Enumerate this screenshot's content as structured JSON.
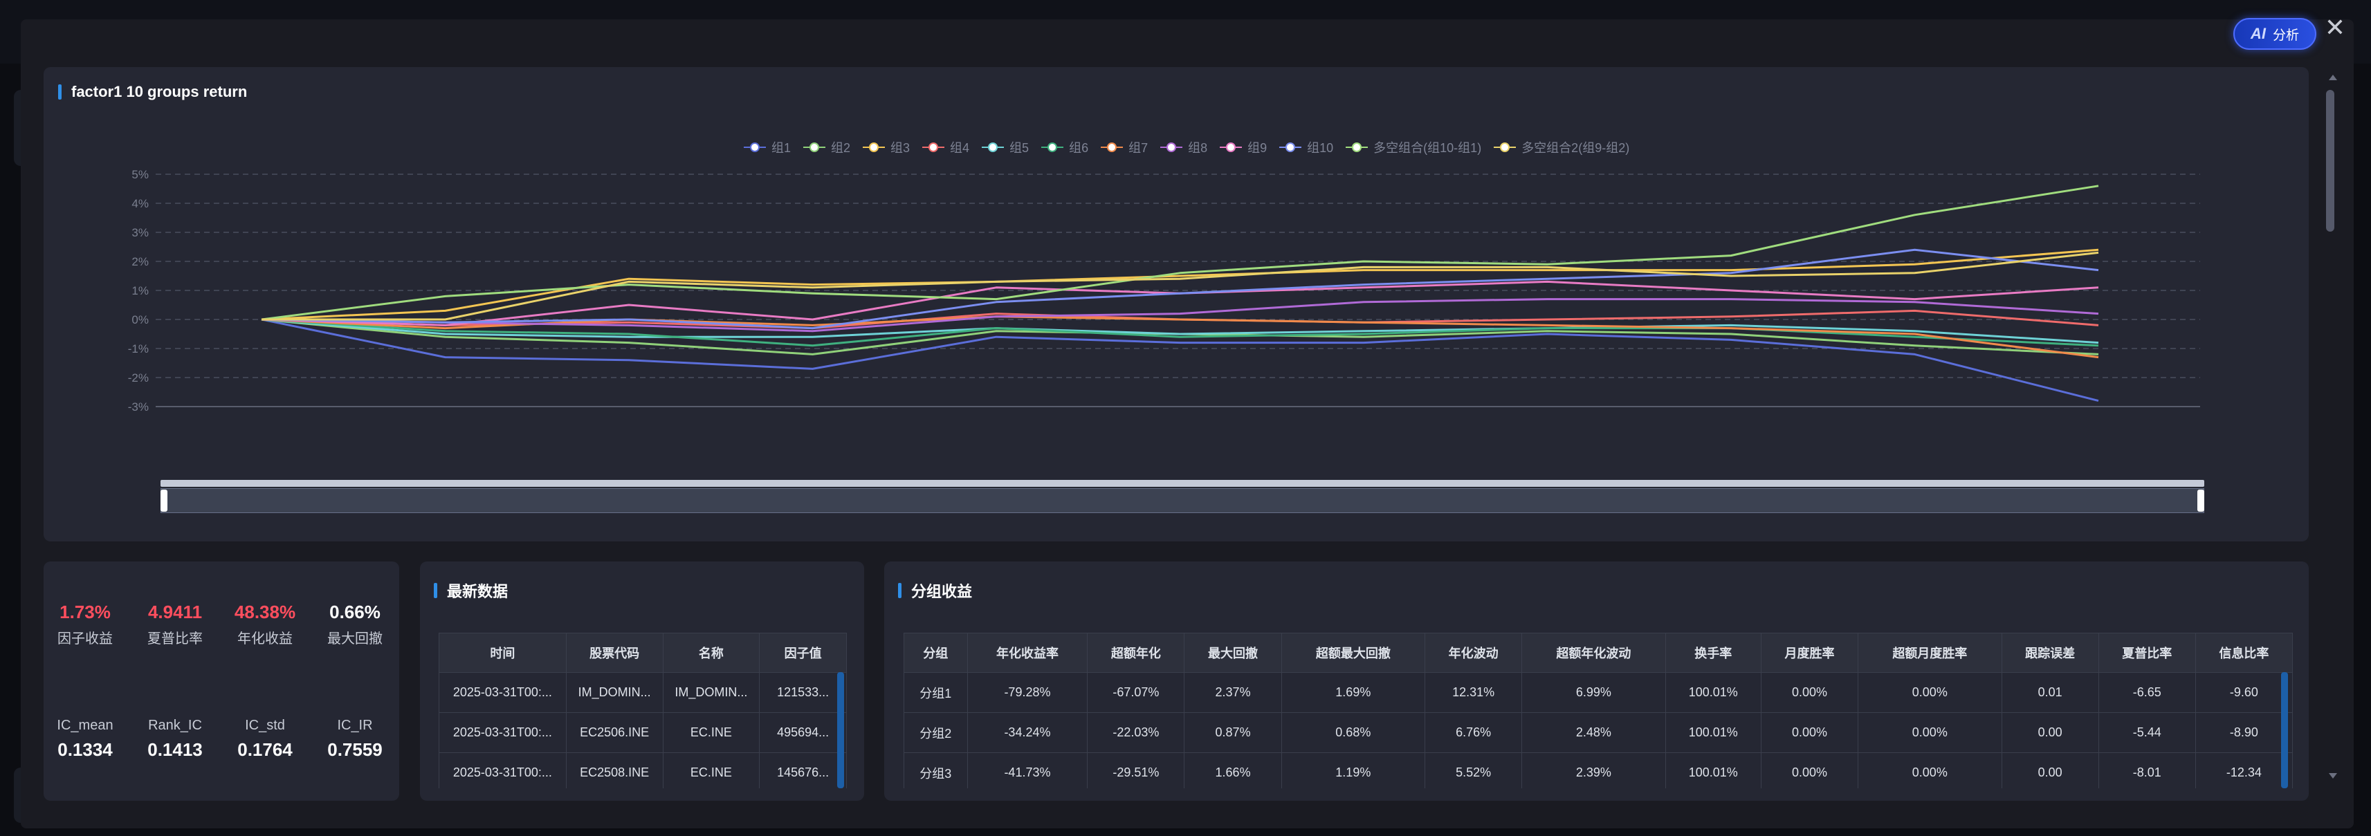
{
  "modal": {
    "close_icon": "close-icon",
    "ai_button": {
      "label": "分析",
      "glyph": "AI"
    }
  },
  "chart_panel": {
    "title": "factor1 10 groups return"
  },
  "chart_data": {
    "type": "line",
    "title": "factor1 10 groups return",
    "y_ticks": [
      "5%",
      "4%",
      "3%",
      "2%",
      "1%",
      "0%",
      "-1%",
      "-2%",
      "-3%"
    ],
    "ylim": [
      -3,
      5
    ],
    "x_count": 11,
    "grid": true,
    "legend_position": "top-center",
    "series": [
      {
        "name": "组1",
        "color": "#5b6ed9",
        "values": [
          0,
          -1.3,
          -1.4,
          -1.7,
          -0.6,
          -0.8,
          -0.8,
          -0.5,
          -0.7,
          -1.2,
          -2.8
        ]
      },
      {
        "name": "组2",
        "color": "#90d17a",
        "values": [
          0,
          -0.6,
          -0.8,
          -1.2,
          -0.4,
          -0.5,
          -0.6,
          -0.4,
          -0.5,
          -0.9,
          -1.2
        ]
      },
      {
        "name": "组3",
        "color": "#f3c552",
        "values": [
          0,
          0.3,
          1.4,
          1.2,
          1.3,
          1.5,
          1.7,
          1.7,
          1.7,
          1.9,
          2.4
        ]
      },
      {
        "name": "组4",
        "color": "#ef6b6b",
        "values": [
          0,
          -0.2,
          -0.1,
          -0.3,
          0.2,
          0.0,
          -0.1,
          0.0,
          0.1,
          0.3,
          -0.2
        ]
      },
      {
        "name": "组5",
        "color": "#6ed2d6",
        "values": [
          0,
          -0.5,
          -0.6,
          -0.6,
          -0.3,
          -0.5,
          -0.4,
          -0.3,
          -0.2,
          -0.4,
          -0.8
        ]
      },
      {
        "name": "组6",
        "color": "#3fb07f",
        "values": [
          0,
          -0.4,
          -0.5,
          -0.9,
          -0.3,
          -0.6,
          -0.5,
          -0.3,
          -0.3,
          -0.6,
          -0.9
        ]
      },
      {
        "name": "组7",
        "color": "#f08a4b",
        "values": [
          0,
          -0.3,
          0.0,
          -0.2,
          0.1,
          0.0,
          -0.1,
          -0.2,
          -0.3,
          -0.5,
          -1.3
        ]
      },
      {
        "name": "组8",
        "color": "#b06ad6",
        "values": [
          0,
          -0.1,
          -0.2,
          -0.4,
          0.1,
          0.2,
          0.6,
          0.7,
          0.7,
          0.6,
          0.2
        ]
      },
      {
        "name": "组9",
        "color": "#e87bc4",
        "values": [
          0,
          -0.2,
          0.5,
          0.0,
          1.1,
          0.9,
          1.1,
          1.3,
          1.0,
          0.7,
          1.1
        ]
      },
      {
        "name": "组10",
        "color": "#7b8ef0",
        "values": [
          0,
          -0.1,
          0.0,
          -0.3,
          0.6,
          0.9,
          1.2,
          1.4,
          1.6,
          2.4,
          1.7
        ]
      },
      {
        "name": "多空组合(组10-组1)",
        "color": "#a0dc7e",
        "values": [
          0,
          0.8,
          1.2,
          0.9,
          0.7,
          1.6,
          2.0,
          1.9,
          2.2,
          3.6,
          4.6
        ]
      },
      {
        "name": "多空组合2(组9-组2)",
        "color": "#e9d26a",
        "values": [
          0,
          0.0,
          1.3,
          1.1,
          1.3,
          1.4,
          1.8,
          1.8,
          1.5,
          1.6,
          2.3
        ]
      }
    ]
  },
  "metrics": {
    "row1": [
      {
        "value": "1.73%",
        "label": "因子收益",
        "tone": "red"
      },
      {
        "value": "4.9411",
        "label": "夏普比率",
        "tone": "red"
      },
      {
        "value": "48.38%",
        "label": "年化收益",
        "tone": "red"
      },
      {
        "value": "0.66%",
        "label": "最大回撤",
        "tone": "white"
      }
    ],
    "row2": [
      {
        "label": "IC_mean",
        "value": "0.1334"
      },
      {
        "label": "Rank_IC",
        "value": "0.1413"
      },
      {
        "label": "IC_std",
        "value": "0.1764"
      },
      {
        "label": "IC_IR",
        "value": "0.7559"
      }
    ]
  },
  "latest_data": {
    "title": "最新数据",
    "columns": [
      "时间",
      "股票代码",
      "名称",
      "因子值"
    ],
    "rows": [
      [
        "2025-03-31T00:...",
        "IM_DOMIN...",
        "IM_DOMIN...",
        "121533..."
      ],
      [
        "2025-03-31T00:...",
        "EC2506.INE",
        "EC.INE",
        "495694..."
      ],
      [
        "2025-03-31T00:...",
        "EC2508.INE",
        "EC.INE",
        "145676..."
      ]
    ]
  },
  "group_returns": {
    "title": "分组收益",
    "columns": [
      "分组",
      "年化收益率",
      "超额年化",
      "最大回撤",
      "超额最大回撤",
      "年化波动",
      "超额年化波动",
      "换手率",
      "月度胜率",
      "超额月度胜率",
      "跟踪误差",
      "夏普比率",
      "信息比率"
    ],
    "rows": [
      [
        "分组1",
        "-79.28%",
        "-67.07%",
        "2.37%",
        "1.69%",
        "12.31%",
        "6.99%",
        "100.01%",
        "0.00%",
        "0.00%",
        "0.01",
        "-6.65",
        "-9.60"
      ],
      [
        "分组2",
        "-34.24%",
        "-22.03%",
        "0.87%",
        "0.68%",
        "6.76%",
        "2.48%",
        "100.01%",
        "0.00%",
        "0.00%",
        "0.00",
        "-5.44",
        "-8.90"
      ],
      [
        "分组3",
        "-41.73%",
        "-29.51%",
        "1.66%",
        "1.19%",
        "5.52%",
        "2.39%",
        "100.01%",
        "0.00%",
        "0.00%",
        "0.00",
        "-8.01",
        "-12.34"
      ]
    ]
  }
}
